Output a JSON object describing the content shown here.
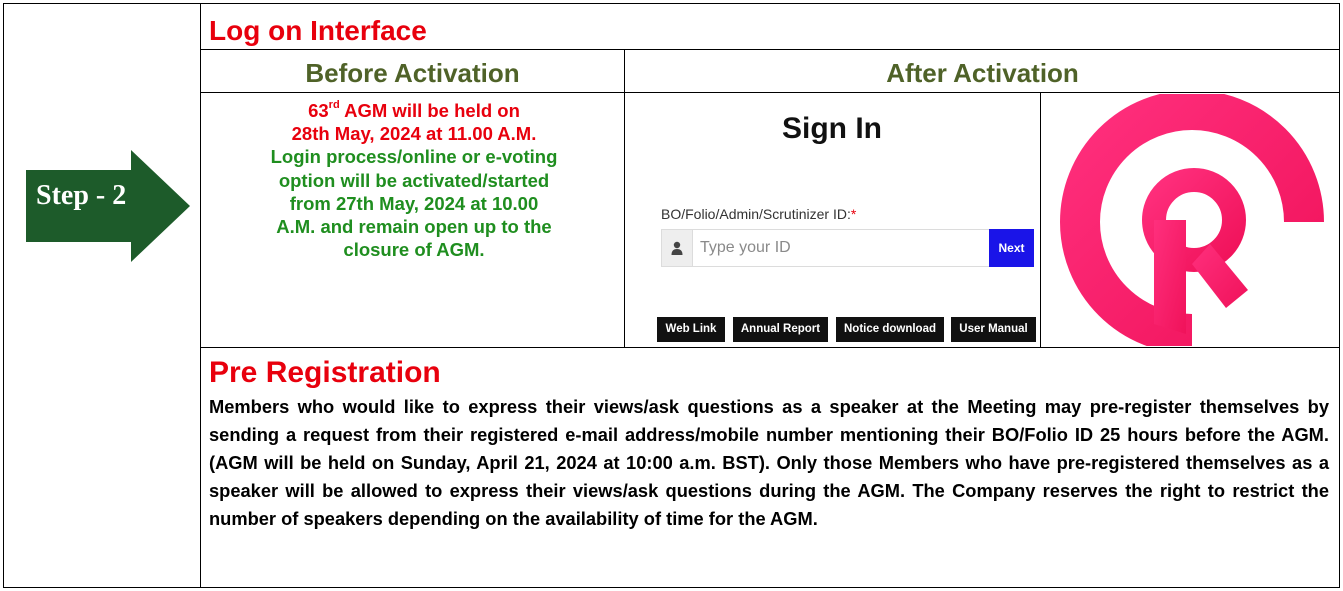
{
  "step": {
    "label": "Step - 2",
    "arrow_color": "#1d5b2a"
  },
  "log_on": {
    "title": "Log on Interface",
    "before_heading": "Before Activation",
    "after_heading": "After Activation"
  },
  "before_activation": {
    "agm_number": "63",
    "agm_sup": "rd",
    "agm_rest": " AGM will be held on",
    "agm_date": "28th May, 2024 at 11.00 A.M.",
    "green_lines": [
      "Login process/online or e-voting",
      "option will be activated/started",
      "from 27th May, 2024 at 10.00",
      "A.M. and remain open up to the",
      "closure of AGM."
    ]
  },
  "sign_in": {
    "title": "Sign In",
    "field_label": "BO/Folio/Admin/Scrutinizer ID:",
    "required_mark": "*",
    "input_placeholder": "Type your ID",
    "input_icon": "user-icon",
    "next_label": "Next",
    "next_color": "#1a14e8",
    "buttons": [
      "Web Link",
      "Annual Report",
      "Notice download",
      "User Manual"
    ]
  },
  "logo": {
    "icon": "spiral-r-logo",
    "colors": [
      "#ff2f7d",
      "#f0125a"
    ]
  },
  "pre_registration": {
    "title": "Pre Registration",
    "body": "Members who would like to express their views/ask questions as a speaker at the Meeting may pre-register themselves by sending a request from their registered e-mail address/mobile number mentioning their BO/Folio ID 25 hours before the AGM. (AGM will be held on Sunday, April 21, 2024 at 10:00 a.m. BST). Only those Members who have pre-registered themselves as a speaker will be allowed to express their views/ask questions during the AGM. The Company reserves the right to restrict the number of speakers depending on the availability of time for the AGM."
  },
  "colors": {
    "title_red": "#e8000d",
    "heading_olive": "#4f6228",
    "body_green": "#1f8e1f"
  }
}
